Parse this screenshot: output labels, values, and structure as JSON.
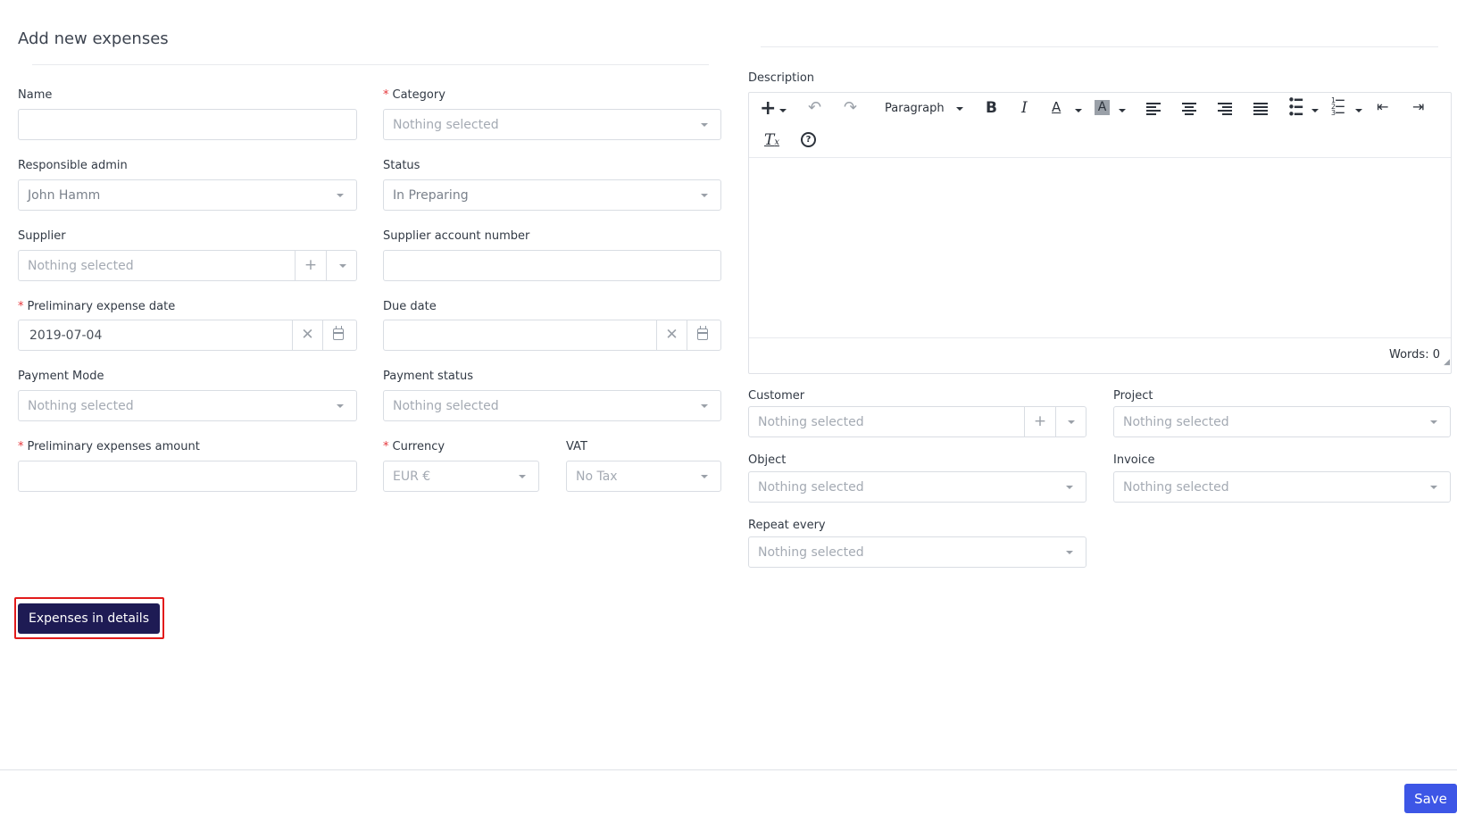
{
  "page": {
    "title": "Add new expenses"
  },
  "form": {
    "name": {
      "label": "Name",
      "value": ""
    },
    "category": {
      "label": "Category",
      "placeholder": "Nothing selected"
    },
    "responsible_admin": {
      "label": "Responsible admin",
      "value": "John Hamm"
    },
    "status": {
      "label": "Status",
      "value": "In Preparing"
    },
    "supplier": {
      "label": "Supplier",
      "placeholder": "Nothing selected"
    },
    "supplier_account_number": {
      "label": "Supplier account number",
      "value": ""
    },
    "preliminary_expense_date": {
      "label": "Preliminary expense date",
      "value": "2019-07-04"
    },
    "due_date": {
      "label": "Due date",
      "value": ""
    },
    "payment_mode": {
      "label": "Payment Mode",
      "placeholder": "Nothing selected"
    },
    "payment_status": {
      "label": "Payment status",
      "placeholder": "Nothing selected"
    },
    "preliminary_expenses_amount": {
      "label": "Preliminary expenses amount",
      "value": ""
    },
    "currency": {
      "label": "Currency",
      "value": "EUR €"
    },
    "vat": {
      "label": "VAT",
      "value": "No Tax"
    },
    "required_mark": "*"
  },
  "description": {
    "label": "Description",
    "block_format": "Paragraph",
    "words_label": "Words: 0",
    "toolbar_icons": [
      "plus-icon",
      "undo-icon",
      "redo-icon",
      "bold-icon",
      "italic-icon",
      "text-color-icon",
      "background-color-icon",
      "align-left-icon",
      "align-center-icon",
      "align-right-icon",
      "align-justify-icon",
      "bullet-list-icon",
      "numbered-list-icon",
      "outdent-icon",
      "indent-icon",
      "clear-formatting-icon",
      "help-icon"
    ]
  },
  "right_form": {
    "customer": {
      "label": "Customer",
      "placeholder": "Nothing selected"
    },
    "project": {
      "label": "Project",
      "placeholder": "Nothing selected"
    },
    "object": {
      "label": "Object",
      "placeholder": "Nothing selected"
    },
    "invoice": {
      "label": "Invoice",
      "placeholder": "Nothing selected"
    },
    "repeat_every": {
      "label": "Repeat every",
      "placeholder": "Nothing selected"
    }
  },
  "actions": {
    "expenses_in_details": "Expenses in details",
    "save": "Save"
  },
  "colors": {
    "primary_dark": "#1e1b54",
    "save_blue": "#3d56e6",
    "required_red": "#e5363b",
    "highlight_red": "#e21b1b"
  }
}
